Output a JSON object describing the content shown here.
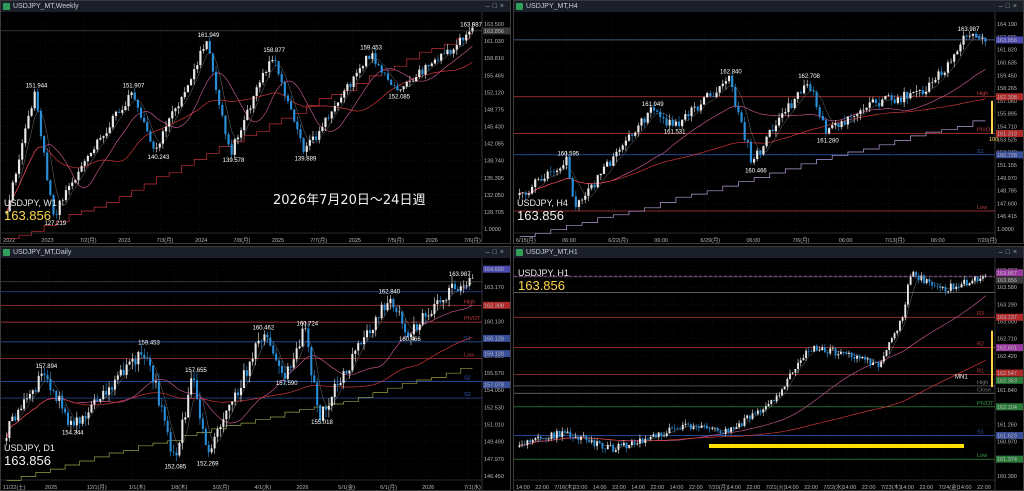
{
  "panels": [
    {
      "id": "weekly",
      "title": "USDJPY_MT,Weekly",
      "symbol": "USDJPY, W1",
      "price": "163.856",
      "y_ticks": [
        "163.500",
        "161.030",
        "158.810",
        "155.465",
        "152.120",
        "148.775",
        "145.430",
        "142.085",
        "138.740",
        "135.395",
        "132.050",
        "128.705",
        "1.0000"
      ],
      "x_ticks": [
        "2022",
        "2023",
        "7/2(月)",
        "2023",
        "7/3(月)",
        "2024",
        "7/8(月)",
        "2025",
        "7/7(月)",
        "2025",
        "7/5(月)",
        "2026",
        "7/6(月)"
      ],
      "peaks": [
        "151.944",
        "151.907",
        "161.949",
        "158.877",
        "159.453",
        "163.987"
      ],
      "troughs": [
        "127.219",
        "140.243",
        "139.578",
        "139.889",
        "152.085"
      ],
      "price_labels": [
        "163.856"
      ]
    },
    {
      "id": "h4",
      "title": "USDJPY_MT,H4",
      "symbol": "USDJPY, H4",
      "price": "163.856",
      "y_ticks": [
        "164.190",
        "163.005",
        "161.820",
        "160.635",
        "159.450",
        "158.265",
        "157.080",
        "155.895",
        "154.710",
        "153.525",
        "152.340",
        "151.155",
        "149.970",
        "148.785",
        "147.600",
        "146.415",
        "1.0000"
      ],
      "x_ticks": [
        "6/15(月)",
        "06:00",
        "6/22(月)",
        "06:00",
        "6/29(月)",
        "06:00",
        "7/6(月)",
        "06:00",
        "7/13(月)",
        "06:00",
        "7/20(月)"
      ],
      "peaks": [
        "160.595",
        "161.949",
        "162.840",
        "162.708",
        "163.987"
      ],
      "troughs": [
        "160.466",
        "161.531",
        "161.280"
      ],
      "levels": [
        "R1",
        "High",
        "PIVOT",
        "S1",
        "Low"
      ],
      "price_labels": [
        "163.856",
        "162.308",
        "161.313",
        "160.728"
      ],
      "side_label": "100"
    },
    {
      "id": "daily",
      "title": "USDJPY_MT,Daily",
      "symbol": "USDJPY, D1",
      "price": "163.856",
      "y_ticks": [
        "164.690",
        "163.170",
        "162.450",
        "160.130",
        "158.610",
        "157.090",
        "155.570",
        "154.050",
        "152.530",
        "151.010",
        "149.490",
        "147.970",
        "146.450"
      ],
      "x_ticks": [
        "11/22(土)",
        "2025",
        "12/1(月)",
        "1/1(木)",
        "1/8(木)",
        "3/2(月)",
        "4/1(水)",
        "2026",
        "5/1(金)",
        "6/1(月)",
        "2026",
        "7/1(水)"
      ],
      "peaks": [
        "157.894",
        "159.453",
        "157.655",
        "160.462",
        "160.724",
        "162.840",
        "163.987"
      ],
      "troughs": [
        "154.344",
        "152.085",
        "152.269",
        "157.590",
        "155.018",
        "160.466"
      ],
      "levels": [
        "R1",
        "High",
        "PIVOT",
        "S1",
        "Low",
        "S2",
        "S3"
      ],
      "price_labels": [
        "164.690",
        "162.308",
        "160.128",
        "159.128",
        "157.078"
      ]
    },
    {
      "id": "h1",
      "title": "USDJPY_MT,H1",
      "symbol": "USDJPY, H1",
      "price": "163.856",
      "y_ticks": [
        "163.867",
        "163.580",
        "163.290",
        "163.000",
        "162.710",
        "162.420",
        "162.130",
        "161.840",
        "161.550",
        "161.260",
        "160.970",
        "160.680",
        "160.390"
      ],
      "x_ticks": [
        "14:00",
        "22:00",
        "7/16(木)",
        "22:00",
        "14:00",
        "22:00",
        "14:00",
        "22:00",
        "14:00",
        "22:00",
        "7/20(月)",
        "14:00",
        "22:00",
        "7/21(火)",
        "14:00",
        "22:00",
        "7/22(水)",
        "14:00",
        "22:00",
        "7/23(木)",
        "14:00",
        "22:00",
        "7/24(金)",
        "14:00",
        "22:00"
      ],
      "levels": [
        "R3",
        "R2",
        "R1",
        "High",
        "Close",
        "PIVOT",
        "S1",
        "Low"
      ],
      "price_labels": [
        "163.867",
        "163.856",
        "163.137",
        "162.601",
        "162.547",
        "162.363",
        "162.104",
        "161.623",
        "161.374"
      ],
      "annotation": "MN1"
    }
  ],
  "overlay_text": "2026年7月20日～24日週",
  "colors": {
    "up": "#e8e8e8",
    "down": "#2a8fd8",
    "ma_short": "#d9d9d9",
    "ma_mid": "#d15a9a",
    "ma_long": "#e33b3b",
    "highlight": "#ffe000",
    "price_label_bg": "#3a3a3a",
    "price": "#ffd84a"
  },
  "chart_data": [
    {
      "type": "candlestick",
      "title": "USDJPY_MT,Weekly",
      "series": [
        {
          "name": "USDJPY, W1"
        }
      ],
      "swing_highs": [
        151.944,
        151.907,
        161.949,
        158.877,
        159.453,
        163.987
      ],
      "swing_lows": [
        127.219,
        140.243,
        139.578,
        139.889,
        152.085
      ],
      "last_price": 163.856,
      "ylim": [
        127.0,
        165.0
      ],
      "grid": true
    },
    {
      "type": "candlestick",
      "title": "USDJPY_MT,H4",
      "series": [
        {
          "name": "USDJPY, H4"
        }
      ],
      "swing_highs": [
        160.595,
        161.949,
        162.84,
        162.708,
        163.987
      ],
      "swing_lows": [
        160.466,
        161.531,
        161.28
      ],
      "last_price": 163.856,
      "ylim": [
        158.5,
        164.5
      ],
      "grid": true
    },
    {
      "type": "candlestick",
      "title": "USDJPY_MT,Daily",
      "series": [
        {
          "name": "USDJPY, D1"
        }
      ],
      "swing_highs": [
        157.894,
        159.453,
        157.655,
        160.462,
        160.724,
        162.84,
        163.987
      ],
      "swing_lows": [
        154.344,
        152.085,
        152.269,
        157.59,
        155.018,
        160.466
      ],
      "last_price": 163.856,
      "ylim": [
        150.5,
        164.8
      ],
      "grid": true
    },
    {
      "type": "candlestick",
      "title": "USDJPY_MT,H1",
      "series": [
        {
          "name": "USDJPY, H1"
        }
      ],
      "last_price": 163.856,
      "ylim": [
        160.3,
        164.0
      ],
      "grid": true
    }
  ]
}
